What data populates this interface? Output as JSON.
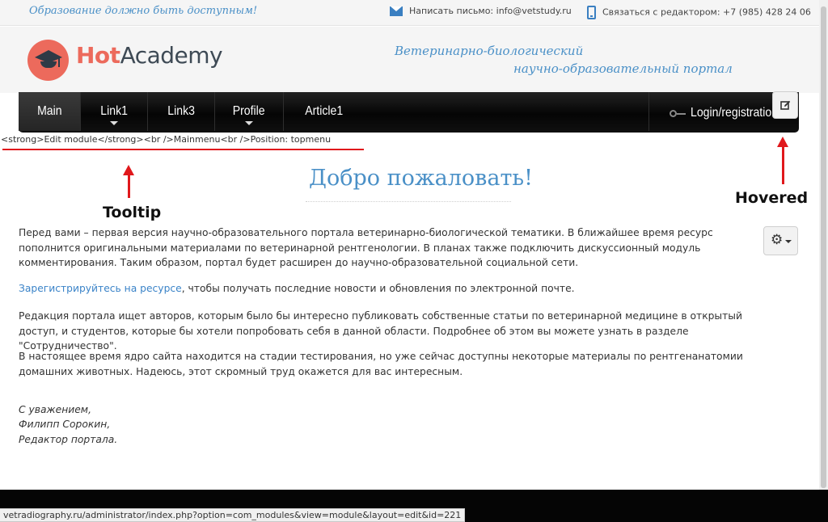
{
  "topbar": {
    "slogan": "Образование должно быть доступным!",
    "mail": "Написать письмо: info@vetstudy.ru",
    "phone": "Связаться с редактором: +7 (985) 428 24 06",
    "mail_icon": "envelope-icon",
    "phone_icon": "mobile-phone-icon"
  },
  "logo": {
    "part1": "Hot",
    "part2": "Academy",
    "icon": "graduation-cap-icon",
    "accent": "#ec6a5c"
  },
  "portal": {
    "line1": "Ветеринарно-биологический",
    "line2": "научно-образовательный портал"
  },
  "nav": {
    "items": [
      {
        "label": "Main",
        "active": true
      },
      {
        "label": "Link1",
        "dropdown": true
      },
      {
        "label": "Link3"
      },
      {
        "label": "Profile",
        "dropdown": true
      },
      {
        "label": "Article1"
      }
    ],
    "login": "Login/registration",
    "login_icon": "key-icon",
    "edit_icon": "edit-icon"
  },
  "tooltip": "<strong>Edit module</strong><br />Mainmenu<br />Position: topmenu",
  "annotations": {
    "tooltip": "Tooltip",
    "hovered": "Hovered",
    "color": "#e0181c"
  },
  "content": {
    "title": "Добро пожаловать!",
    "p1": "Перед вами – первая версия научно-образовательного портала ветеринарно-биологической тематики. В ближайшее время ресурс пополнится оригинальными материалами по ветеринарной рентгенологии. В планах также подключить дискуссионный модуль комментирования. Таким образом, портал будет расширен до научно-образовательной социальной сети.",
    "p2_link": "Зарегистрируйтесь на ресурсе",
    "p2_rest": ", чтобы получать последние новости и обновления по электронной почте.",
    "p3": "Редакция портала ищет авторов, которым было бы интересно публиковать собственные статьи по ветеринарной медицине в открытый доступ, и студентов, которые бы хотели попробовать себя в данной области. Подробнее об этом вы можете узнать в разделе \"Сотрудничество\".",
    "p4": "В настоящее время ядро сайта находится на стадии тестирования, но уже сейчас доступны некоторые материалы по рентгенанатомии домашних животных. Надеюсь, этот скромный труд окажется для вас интересным.",
    "sig1": "С уважением,",
    "sig2": "Филипп Сорокин,",
    "sig3": "Редактор портала.",
    "gear_icon": "gear-icon"
  },
  "statusbar": "vetradiography.ru/administrator/index.php?option=com_modules&view=module&layout=edit&id=221"
}
